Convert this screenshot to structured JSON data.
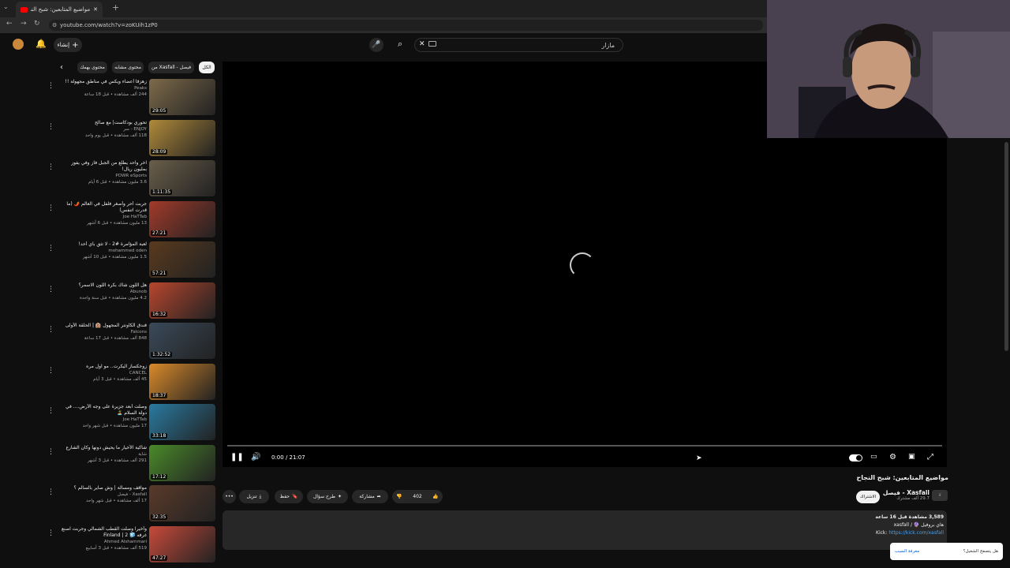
{
  "browser": {
    "tab_title": "مواضيع المتابعين: شبح النجاح -",
    "url": "youtube.com/watch?v=zoKUih1zP0"
  },
  "masthead": {
    "search_value": "مازار",
    "create_label": "إنشاء"
  },
  "chips": [
    "الكل",
    "من Xasfall - فيصل",
    "محتوى مشابه",
    "محتوى يهمك"
  ],
  "recommendations": [
    {
      "title": "زهزقا أعضاء ويكس في مناطق مجهولة !!",
      "channel": "Peaks",
      "views": "244 ألف مشاهدة • قبل 18 ساعة",
      "duration": "29:05",
      "color": "#7d6a4a"
    },
    {
      "title": "تحوري بودكاست| مع صالح",
      "channel": "ENJOY - سر",
      "views": "118 ألف مشاهدة • قبل يوم واحد",
      "duration": "28:09",
      "color": "#b08a3a"
    },
    {
      "title": "آخر واحد يطلع من الجبل فاز وفي يفوز بمليون ريال!",
      "channel": "POWR eSports",
      "views": "3.6 مليون مشاهدة • قبل 6 أيام",
      "duration": "1:11:35",
      "color": "#6a5e4a"
    },
    {
      "title": "جربت أحر وأصغر فلفل في العالم 🌶️ (ما قدرت اتنفس)",
      "channel": "Joe HaTTab",
      "views": "13 مليون مشاهدة • قبل 6 أشهر",
      "duration": "27:21",
      "color": "#a23a2a"
    },
    {
      "title": "لعبة المؤامرة #2 - لا تثق بأي أحد!",
      "channel": "mohammed oden",
      "views": "1.5 مليون مشاهدة • قبل 10 أشهر",
      "duration": "57:21",
      "color": "#5a3a1e"
    },
    {
      "title": "هل اللون شاك بكره اللون الاسمر؟",
      "channel": "Abunob",
      "views": "4.2 مليون مشاهدة • قبل سنة واحدة",
      "duration": "16:32",
      "color": "#b8462e"
    },
    {
      "title": "فندق الكاونتر المجهول 🏨 | الحلقة الأولى",
      "channel": "Falcons",
      "views": "848 ألف مشاهدة • قبل 17 ساعة",
      "duration": "1:32:52",
      "color": "#3a4a5a"
    },
    {
      "title": "زوجكساز اليكرت.. مو اول مره",
      "channel": "CANCEL",
      "views": "45 ألف مشاهدة • قبل 3 أيام",
      "duration": "18:37",
      "color": "#d98a2a"
    },
    {
      "title": "وصلت أبعد جزيرة على وجه الأرض.... في دولة السلام 🏝️",
      "channel": "Joe HaTTab",
      "views": "17 مليون مشاهدة • قبل شهر واحد",
      "duration": "33:18",
      "color": "#2a7aa0"
    },
    {
      "title": "شاكية الأخيار ما يحيش دونها وكان الشارع",
      "channel": "شاية",
      "views": "291 ألف مشاهدة • قبل 3 أشهر",
      "duration": "17:12",
      "color": "#4a8a2a"
    },
    {
      "title": "مواقف ومسألة | وش صاير بالسالم ؟",
      "channel": "Xasfall - فيصل",
      "views": "17 ألف مشاهدة • قبل شهر واحد",
      "duration": "32:35",
      "color": "#5a3a2a"
    },
    {
      "title": "وأخيرا وصلت القطب الشمالي وجربت اصنع غرفه 🧊 Finland | 2",
      "channel": "Ahmed Alshammari",
      "views": "519 ألف مشاهدة • قبل 3 أسابيع",
      "duration": "47:27",
      "color": "#c84a3a"
    }
  ],
  "player": {
    "time_label": "0:00 / 21:07"
  },
  "video": {
    "title": "مواضيع المتابعين: شبح النجاح",
    "channel_name": "Xasfall - فيصل",
    "subscribers": "29.7 ألف مشترك",
    "join_label": "الاشتراك",
    "like_count": "402",
    "share_label": "مشاركة",
    "ask_label": "طرح سؤال",
    "save_label": "حفظ",
    "download_label": "تنزيل",
    "description_meta": "3,589 مشاهدة قبل 16 ساعة",
    "desc_line1": "هاي بروفيل 🔮 / xasfall",
    "desc_kick_prefix": "Kick:",
    "desc_kick_url": "https://kick.com/xasfall"
  },
  "popup": {
    "question": "هل يتصفح الشغيل؟",
    "action": "معرفة السبب"
  }
}
